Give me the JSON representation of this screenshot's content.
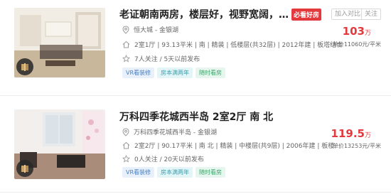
{
  "listings": [
    {
      "title": "老证朝南两房，楼层好，视野宽阔，采光好，",
      "hot_tag": "必看好房",
      "compare_label": "加入对比",
      "follow_label": "关注",
      "community": "恒大城 - 金银湖",
      "info": "2室1厅 | 93.13平米 | 南 | 精装 | 低楼层(共32层) | 2012年建 | 板塔结合",
      "follow_info": "7人关注 / 5天以前发布",
      "tags": [
        "VR看装修",
        "房本满两年",
        "随时看房"
      ],
      "price_value": "103",
      "price_unit": "万",
      "unit_price": "单价11060元/平米"
    },
    {
      "title": "万科四季花城西半岛 2室2厅 南 北",
      "community": "万科四季花城西半岛 - 金银湖",
      "info": "2室2厅 | 90.17平米 | 南 北 | 精装 | 中楼层(共9层) | 2006年建 | 板楼",
      "follow_info": "0人关注 / 20天以前发布",
      "tags": [
        "VR看装修",
        "房本满两年",
        "随时看房"
      ],
      "price_value": "119.5",
      "price_unit": "万",
      "unit_price": "单价13253元/平米"
    }
  ],
  "colors": {
    "accent_red": "#e4393c",
    "tag_blue": "#4a7fc0",
    "tag_cyan": "#3d9fae",
    "tag_green": "#3aa768"
  },
  "icons": [
    "location-icon",
    "home-icon",
    "star-icon",
    "vr-icon"
  ]
}
